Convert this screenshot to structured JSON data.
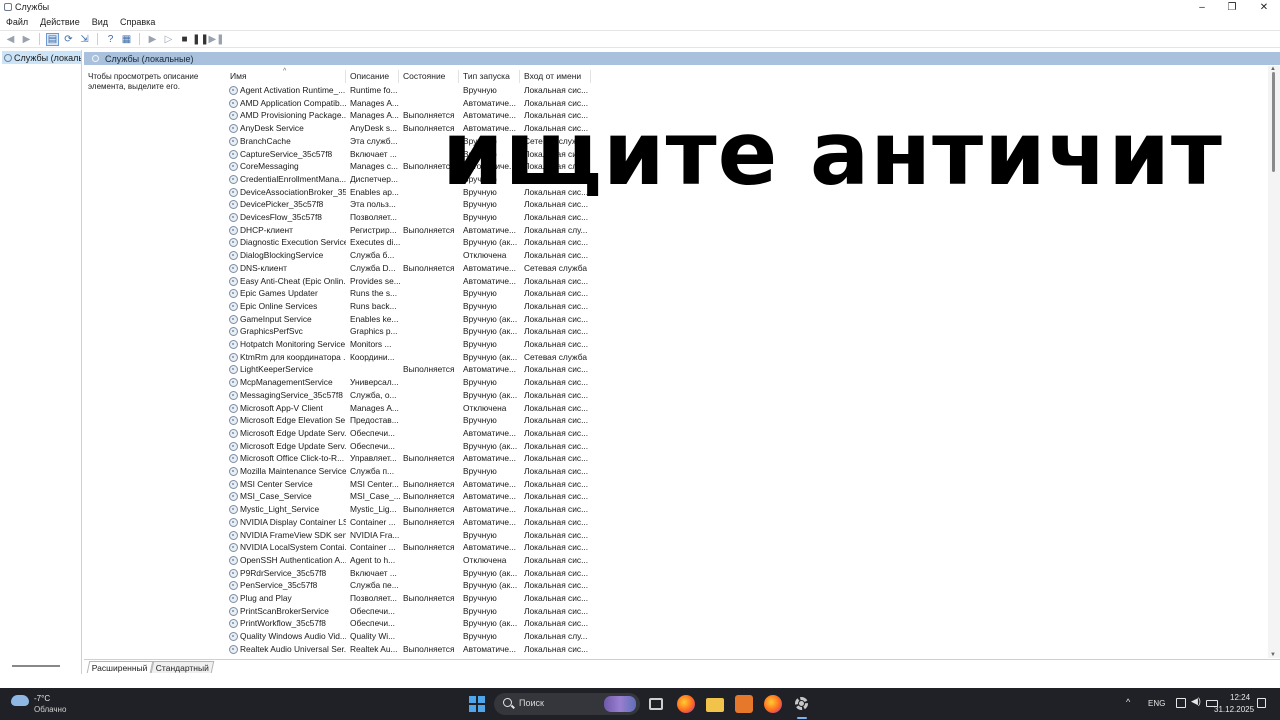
{
  "window": {
    "title": "Службы"
  },
  "menu": [
    "Файл",
    "Действие",
    "Вид",
    "Справка"
  ],
  "toolbar": {
    "icons": [
      "back-icon",
      "forward-icon",
      "show-hide-console-tree-icon",
      "refresh-icon",
      "export-list-icon",
      "help-icon",
      "properties-icon",
      "start-service-icon",
      "start-service-alt-icon",
      "stop-service-icon",
      "pause-service-icon",
      "restart-service-icon"
    ]
  },
  "tree": {
    "selected_label": "Службы (локалы"
  },
  "panel": {
    "header": "Службы (локальные)",
    "description": "Чтобы просмотреть описание элемента, выделите его."
  },
  "table": {
    "columns": [
      "Имя",
      "Описание",
      "Состояние",
      "Тип запуска",
      "Вход от имени"
    ],
    "rows": [
      [
        "Agent Activation Runtime_...",
        "Runtime fo...",
        "",
        "Вручную",
        "Локальная сис..."
      ],
      [
        "AMD Application Compatib...",
        "Manages A...",
        "",
        "Автоматиче...",
        "Локальная сис..."
      ],
      [
        "AMD Provisioning Package...",
        "Manages A...",
        "Выполняется",
        "Автоматиче...",
        "Локальная сис..."
      ],
      [
        "AnyDesk Service",
        "AnyDesk s...",
        "Выполняется",
        "Автоматиче...",
        "Локальная сис..."
      ],
      [
        "BranchCache",
        "Эта служб...",
        "",
        "Вручную",
        "Сетевая служба"
      ],
      [
        "CaptureService_35c57f8",
        "Включает ...",
        "",
        "Вручную",
        "Локальная сис..."
      ],
      [
        "CoreMessaging",
        "Manages c...",
        "Выполняется",
        "Автоматиче...",
        "Локальная слу..."
      ],
      [
        "CredentialEnrollmentMana...",
        "Диспетчер...",
        "",
        "Вручную",
        "Локальная сис..."
      ],
      [
        "DeviceAssociationBroker_35...",
        "Enables ap...",
        "",
        "Вручную",
        "Локальная сис..."
      ],
      [
        "DevicePicker_35c57f8",
        "Эта польз...",
        "",
        "Вручную",
        "Локальная сис..."
      ],
      [
        "DevicesFlow_35c57f8",
        "Позволяет...",
        "",
        "Вручную",
        "Локальная сис..."
      ],
      [
        "DHCP-клиент",
        "Регистрир...",
        "Выполняется",
        "Автоматиче...",
        "Локальная слу..."
      ],
      [
        "Diagnostic Execution Service",
        "Executes di...",
        "",
        "Вручную (ак...",
        "Локальная сис..."
      ],
      [
        "DialogBlockingService",
        "Служба б...",
        "",
        "Отключена",
        "Локальная сис..."
      ],
      [
        "DNS-клиент",
        "Служба D...",
        "Выполняется",
        "Автоматиче...",
        "Сетевая служба"
      ],
      [
        "Easy Anti-Cheat (Epic Onlin...",
        "Provides se...",
        "",
        "Автоматиче...",
        "Локальная сис..."
      ],
      [
        "Epic Games Updater",
        "Runs the s...",
        "",
        "Вручную",
        "Локальная сис..."
      ],
      [
        "Epic Online Services",
        "Runs back...",
        "",
        "Вручную",
        "Локальная сис..."
      ],
      [
        "GameInput Service",
        "Enables ke...",
        "",
        "Вручную (ак...",
        "Локальная сис..."
      ],
      [
        "GraphicsPerfSvc",
        "Graphics p...",
        "",
        "Вручную (ак...",
        "Локальная сис..."
      ],
      [
        "Hotpatch Monitoring Service",
        "Monitors ...",
        "",
        "Вручную",
        "Локальная сис..."
      ],
      [
        "KtmRm для координатора ...",
        "Координи...",
        "",
        "Вручную (ак...",
        "Сетевая служба"
      ],
      [
        "LightKeeperService",
        "",
        "Выполняется",
        "Автоматиче...",
        "Локальная сис..."
      ],
      [
        "McpManagementService",
        "Универсал...",
        "",
        "Вручную",
        "Локальная сис..."
      ],
      [
        "MessagingService_35c57f8",
        "Служба, о...",
        "",
        "Вручную (ак...",
        "Локальная сис..."
      ],
      [
        "Microsoft App-V Client",
        "Manages A...",
        "",
        "Отключена",
        "Локальная сис..."
      ],
      [
        "Microsoft Edge Elevation Se...",
        "Предостав...",
        "",
        "Вручную",
        "Локальная сис..."
      ],
      [
        "Microsoft Edge Update Serv...",
        "Обеспечи...",
        "",
        "Автоматиче...",
        "Локальная сис..."
      ],
      [
        "Microsoft Edge Update Serv...",
        "Обеспечи...",
        "",
        "Вручную (ак...",
        "Локальная сис..."
      ],
      [
        "Microsoft Office Click-to-R...",
        "Управляет...",
        "Выполняется",
        "Автоматиче...",
        "Локальная сис..."
      ],
      [
        "Mozilla Maintenance Service",
        "Служба п...",
        "",
        "Вручную",
        "Локальная сис..."
      ],
      [
        "MSI Center Service",
        "MSI Center...",
        "Выполняется",
        "Автоматиче...",
        "Локальная сис..."
      ],
      [
        "MSI_Case_Service",
        "MSI_Case_...",
        "Выполняется",
        "Автоматиче...",
        "Локальная сис..."
      ],
      [
        "Mystic_Light_Service",
        "Mystic_Lig...",
        "Выполняется",
        "Автоматиче...",
        "Локальная сис..."
      ],
      [
        "NVIDIA Display Container LS",
        "Container ...",
        "Выполняется",
        "Автоматиче...",
        "Локальная сис..."
      ],
      [
        "NVIDIA FrameView SDK serv...",
        "NVIDIA Fra...",
        "",
        "Вручную",
        "Локальная сис..."
      ],
      [
        "NVIDIA LocalSystem Contai...",
        "Container ...",
        "Выполняется",
        "Автоматиче...",
        "Локальная сис..."
      ],
      [
        "OpenSSH Authentication A...",
        "Agent to h...",
        "",
        "Отключена",
        "Локальная сис..."
      ],
      [
        "P9RdrService_35c57f8",
        "Включает ...",
        "",
        "Вручную (ак...",
        "Локальная сис..."
      ],
      [
        "PenService_35c57f8",
        "Служба пе...",
        "",
        "Вручную (ак...",
        "Локальная сис..."
      ],
      [
        "Plug and Play",
        "Позволяет...",
        "Выполняется",
        "Вручную",
        "Локальная сис..."
      ],
      [
        "PrintScanBrokerService",
        "Обеспечи...",
        "",
        "Вручную",
        "Локальная сис..."
      ],
      [
        "PrintWorkflow_35c57f8",
        "Обеспечи...",
        "",
        "Вручную (ак...",
        "Локальная сис..."
      ],
      [
        "Quality Windows Audio Vid...",
        "Quality Wi...",
        "",
        "Вручную",
        "Локальная слу..."
      ],
      [
        "Realtek Audio Universal Ser...",
        "Realtek Au...",
        "Выполняется",
        "Автоматиче...",
        "Локальная сис..."
      ]
    ]
  },
  "tabs": [
    "Расширенный",
    "Стандартный"
  ],
  "overlay": {
    "text": "ищите античит"
  },
  "taskbar": {
    "weather_temp": "-7°C",
    "weather_condition": "Облачно",
    "search_placeholder": "Поиск",
    "language": "ENG",
    "time": "12:24",
    "date": "31.12.2025"
  },
  "colors": {
    "panel_header": "#a9c1dc",
    "tree_selection": "#cce4f7",
    "taskbar": "#1f2126",
    "start_blue": "#4fa6ea"
  }
}
